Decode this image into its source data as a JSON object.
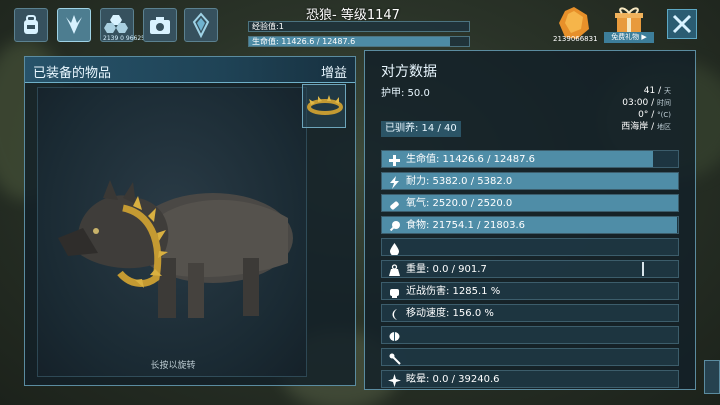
{
  "header": {
    "title": "恐狼- 等级1147",
    "xp_label": "经验值:1",
    "health_label": "生命值: 11426.6 / 12487.6",
    "health_fraction": 0.915,
    "points_small": "2139 0 96625"
  },
  "tabs": [
    {
      "icon": "backpack-icon"
    },
    {
      "icon": "dino-footprint-icon"
    },
    {
      "icon": "engram-hexagon-icon"
    },
    {
      "icon": "camera-icon"
    },
    {
      "icon": "crystal-icon"
    }
  ],
  "currency": {
    "count": "2139066831",
    "icon": "amber-gem-icon"
  },
  "gift": {
    "label": "免费礼物"
  },
  "equipment": {
    "heading": "已装备的物品",
    "bonus_label": "增益",
    "rotate_hint": "长按以旋转"
  },
  "details": {
    "heading": "对方数据",
    "armor": "护甲: 50.0",
    "tamed": "已驯养: 14 / 40",
    "day": "41",
    "day_unit": "天",
    "time": "03:00",
    "time_unit": "时间",
    "temp": "0°",
    "temp_unit": "°(C)",
    "region": "西海岸",
    "region_unit": "地区"
  },
  "stats": [
    {
      "key": "health",
      "icon": "health-cross-icon",
      "label": "生命值: 11426.6 / 12487.6",
      "fraction": 0.915
    },
    {
      "key": "stamina",
      "icon": "stamina-bolt-icon",
      "label": "耐力: 5382.0 / 5382.0",
      "fraction": 1.0
    },
    {
      "key": "oxygen",
      "icon": "oxygen-tank-icon",
      "label": "氧气: 2520.0 / 2520.0",
      "fraction": 1.0
    },
    {
      "key": "food",
      "icon": "food-drumstick-icon",
      "label": "食物: 21754.1 / 21803.6",
      "fraction": 0.998
    },
    {
      "key": "water",
      "icon": "water-drop-icon",
      "label": "",
      "fraction": 0
    },
    {
      "key": "weight",
      "icon": "weight-icon",
      "label": "重量: 0.0 / 901.7",
      "fraction": 0
    },
    {
      "key": "melee",
      "icon": "melee-fist-icon",
      "label": "近战伤害: 1285.1 %",
      "fraction": 0
    },
    {
      "key": "speed",
      "icon": "movement-speed-icon",
      "label": "移动速度: 156.0 %",
      "fraction": 0
    },
    {
      "key": "fortitude",
      "icon": "fortitude-brain-icon",
      "label": "",
      "fraction": 0
    },
    {
      "key": "crafting",
      "icon": "crafting-tools-icon",
      "label": "",
      "fraction": 0
    },
    {
      "key": "torpor",
      "icon": "torpor-icon",
      "label": "眩晕: 0.0 / 39240.6",
      "fraction": 0
    }
  ],
  "colors": {
    "accent": "#4f8da7",
    "panel": "#122028",
    "border": "#5b8ca0"
  }
}
